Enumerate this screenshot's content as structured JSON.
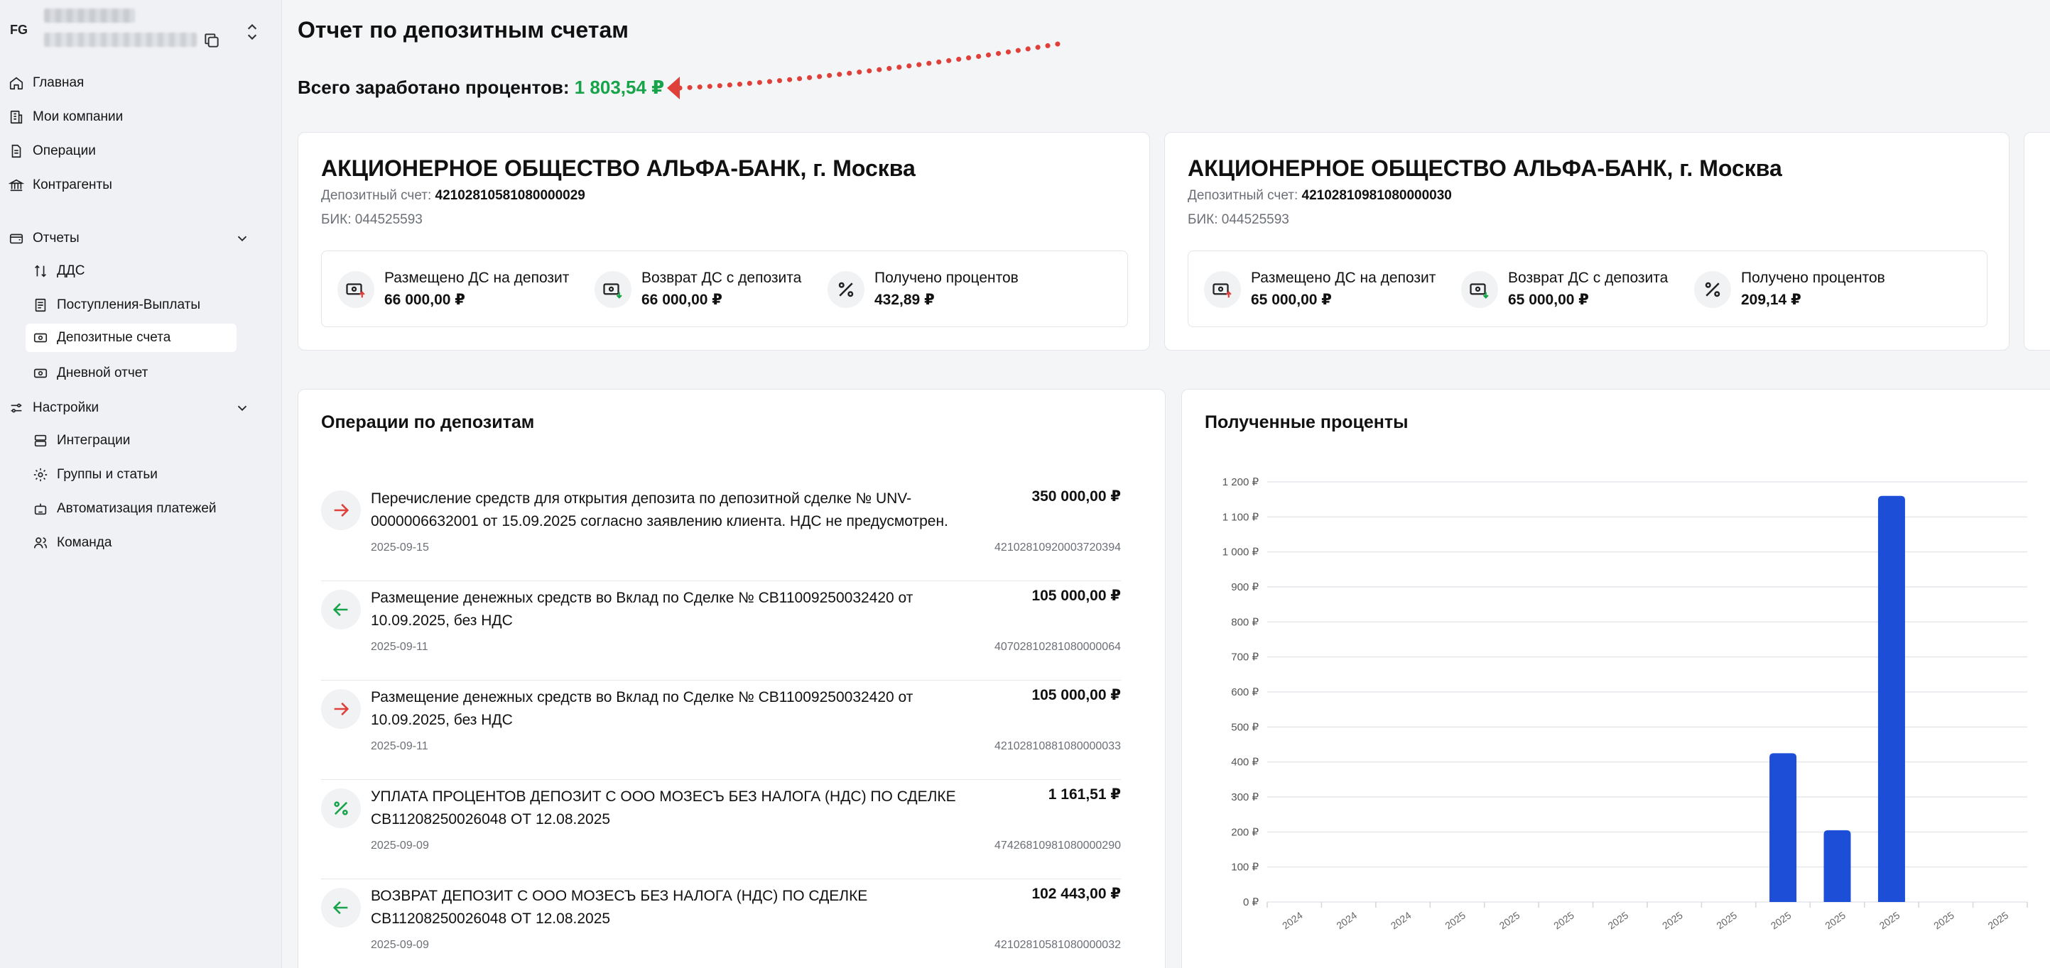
{
  "sidebar": {
    "org_initials": "FG",
    "items": [
      {
        "label": "Главная"
      },
      {
        "label": "Мои компании"
      },
      {
        "label": "Операции"
      },
      {
        "label": "Контрагенты"
      }
    ],
    "reports": {
      "label": "Отчеты",
      "items": [
        {
          "label": "ДДС"
        },
        {
          "label": "Поступления-Выплаты"
        },
        {
          "label": "Депозитные счета"
        },
        {
          "label": "Дневной отчет"
        }
      ]
    },
    "settings": {
      "label": "Настройки",
      "items": [
        {
          "label": "Интеграции"
        },
        {
          "label": "Группы и статьи"
        },
        {
          "label": "Автоматизация платежей"
        },
        {
          "label": "Команда"
        }
      ]
    }
  },
  "page": {
    "title": "Отчет по депозитным счетам",
    "total_label": "Всего заработано процентов:",
    "total_value": "1 803,54 ₽"
  },
  "accounts": [
    {
      "bank": "АКЦИОНЕРНОЕ ОБЩЕСТВО АЛЬФА-БАНК, г. Москва",
      "account_label": "Депозитный счет:",
      "account": "42102810581080000029",
      "bik": "БИК: 044525593",
      "placed_label": "Размещено ДС на депозит",
      "placed": "66 000,00 ₽",
      "returned_label": "Возврат ДС с депозита",
      "returned": "66 000,00 ₽",
      "interest_label": "Получено процентов",
      "interest": "432,89 ₽"
    },
    {
      "bank": "АКЦИОНЕРНОЕ ОБЩЕСТВО АЛЬФА-БАНК, г. Москва",
      "account_label": "Депозитный счет:",
      "account": "42102810981080000030",
      "bik": "БИК: 044525593",
      "placed_label": "Размещено ДС на депозит",
      "placed": "65 000,00 ₽",
      "returned_label": "Возврат ДС с депозита",
      "returned": "65 000,00 ₽",
      "interest_label": "Получено процентов",
      "interest": "209,14 ₽"
    }
  ],
  "operations": {
    "title": "Операции по депозитам",
    "items": [
      {
        "direction": "out",
        "description": "Перечисление средств для открытия депозита по депозитной сделке № UNV-0000006632001 от 15.09.2025 согласно заявлению клиента. НДС не предусмотрен.",
        "amount": "350 000,00 ₽",
        "date": "2025-09-15",
        "account": "42102810920003720394"
      },
      {
        "direction": "in",
        "description": "Размещение денежных средств во Вклад по Сделке № СВ11009250032420 от 10.09.2025, без НДС",
        "amount": "105 000,00 ₽",
        "date": "2025-09-11",
        "account": "40702810281080000064"
      },
      {
        "direction": "out",
        "description": "Размещение денежных средств во Вклад по Сделке № СВ11009250032420 от 10.09.2025, без НДС",
        "amount": "105 000,00 ₽",
        "date": "2025-09-11",
        "account": "42102810881080000033"
      },
      {
        "direction": "interest",
        "description": "УПЛАТА ПРОЦЕНТОВ ДЕПОЗИТ С ООО МОЗЕСЪ БЕЗ НАЛОГА (НДС) ПО СДЕЛКЕ СВ11208250026048 ОТ 12.08.2025",
        "amount": "1 161,51 ₽",
        "date": "2025-09-09",
        "account": "47426810981080000290"
      },
      {
        "direction": "in",
        "description": "ВОЗВРАТ ДЕПОЗИТ С ООО МОЗЕСЪ БЕЗ НАЛОГА (НДС) ПО СДЕЛКЕ СВ11208250026048 ОТ 12.08.2025",
        "amount": "102 443,00 ₽",
        "date": "2025-09-09",
        "account": "42102810581080000032"
      }
    ]
  },
  "chart_data": {
    "type": "bar",
    "title": "Полученные проценты",
    "ylim": [
      0,
      1200
    ],
    "yticks": [
      "0 ₽",
      "100 ₽",
      "200 ₽",
      "300 ₽",
      "400 ₽",
      "500 ₽",
      "600 ₽",
      "700 ₽",
      "800 ₽",
      "900 ₽",
      "1 000 ₽",
      "1 100 ₽",
      "1 200 ₽"
    ],
    "categories": [
      "2024",
      "2024",
      "2024",
      "2025",
      "2025",
      "2025",
      "2025",
      "2025",
      "2025",
      "2025",
      "2025",
      "2025",
      "2025",
      "2025"
    ],
    "values": [
      0,
      0,
      0,
      0,
      0,
      0,
      0,
      0,
      0,
      425,
      205,
      1160,
      0,
      0
    ],
    "grid": true,
    "bar_color": "#1d4ed8"
  },
  "colors": {
    "accent_green": "#17a34a",
    "bar": "#1d4ed8",
    "arrow": "#e0403a"
  }
}
